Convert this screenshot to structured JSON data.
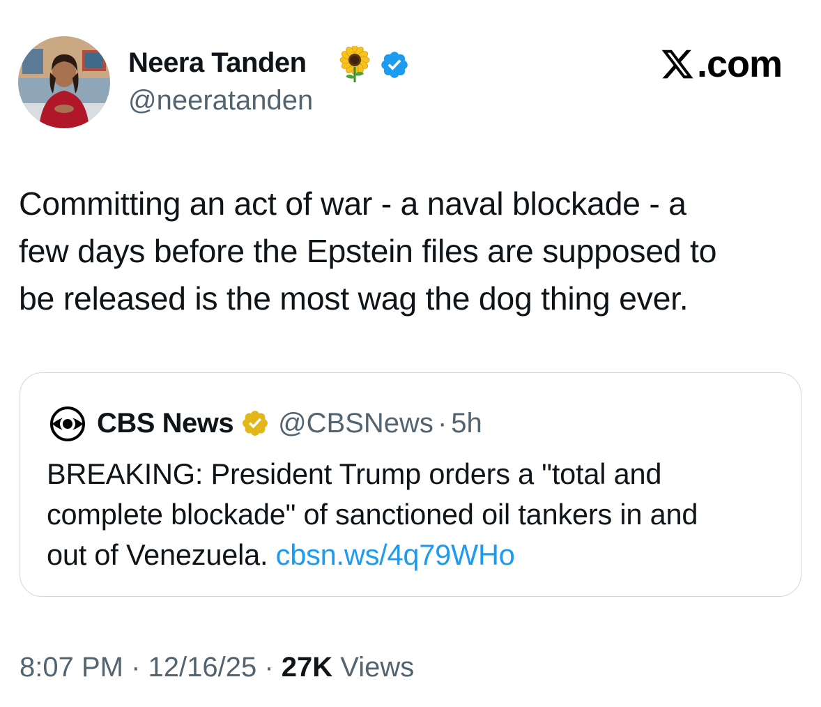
{
  "author": {
    "name": "Neera Tanden",
    "handle": "@neeratanden",
    "name_emoji_icon": "sunflower-icon",
    "verified_icon": "blue-verified-badge-icon"
  },
  "brand": {
    "logo_icon": "x-logo-icon",
    "text": ".com"
  },
  "tweet": {
    "text": "Committing an act of war - a naval blockade - a\nfew days before the Epstein files are supposed to\nbe released is the most wag the dog thing ever."
  },
  "quote": {
    "logo_icon": "cbs-eye-logo-icon",
    "name": "CBS News",
    "verified_icon": "gold-verified-badge-icon",
    "handle": "@CBSNews",
    "separator": "·",
    "time": "5h",
    "text": "BREAKING: President Trump orders a \"total and\ncomplete blockade\" of sanctioned oil tankers in and\nout of Venezuela. ",
    "link": "cbsn.ws/4q79WHo"
  },
  "meta": {
    "time": "8:07 PM",
    "separator": " · ",
    "date": "12/16/25",
    "views_count": "27K",
    "views_label": " Views"
  },
  "colors": {
    "text": "#0f1419",
    "secondary_text": "#536471",
    "link": "#1d9bf0",
    "verified_blue": "#1d9bf0",
    "verified_gold": "#e2b719",
    "card_border": "#cfd9de"
  }
}
